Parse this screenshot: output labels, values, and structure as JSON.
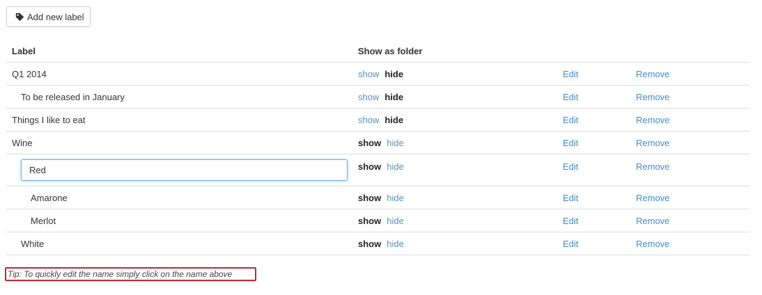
{
  "toolbar": {
    "add_label_button": "Add new label"
  },
  "table": {
    "headers": {
      "label": "Label",
      "show_as_folder": "Show as folder"
    },
    "rows": [
      {
        "label": "Q1 2014",
        "indent": 0,
        "folder": "hide",
        "editing": false
      },
      {
        "label": "To be released in January",
        "indent": 1,
        "folder": "hide",
        "editing": false
      },
      {
        "label": "Things I like to eat",
        "indent": 0,
        "folder": "hide",
        "editing": false
      },
      {
        "label": "Wine",
        "indent": 0,
        "folder": "show",
        "editing": false
      },
      {
        "label": "Red",
        "indent": 1,
        "folder": "show",
        "editing": true
      },
      {
        "label": "Amarone",
        "indent": 2,
        "folder": "show",
        "editing": false
      },
      {
        "label": "Merlot",
        "indent": 2,
        "folder": "show",
        "editing": false
      },
      {
        "label": "White",
        "indent": 1,
        "folder": "show",
        "editing": false
      }
    ],
    "show_text": "show",
    "hide_text": "hide",
    "edit_text": "Edit",
    "remove_text": "Remove"
  },
  "tip": "Tip: To quickly edit the name simply click on the name above",
  "colors": {
    "link": "#428bca",
    "tip_border": "#cc2233",
    "input_focus": "#66afe9"
  }
}
